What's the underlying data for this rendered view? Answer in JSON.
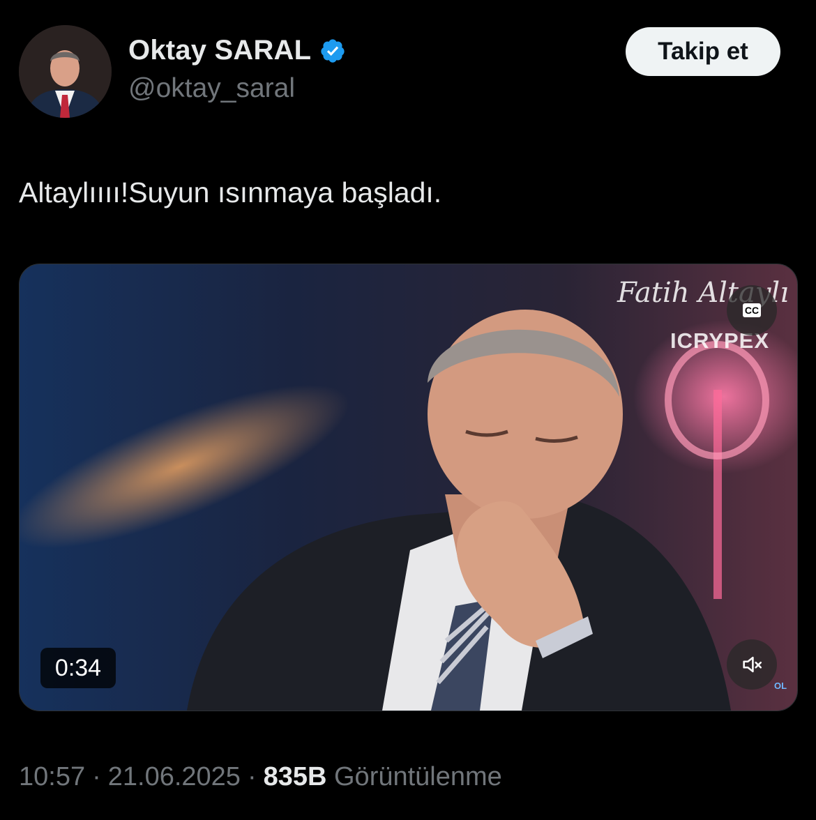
{
  "author": {
    "display_name": "Oktay SARAL",
    "handle": "@oktay_saral",
    "verified_icon": "verified-badge-icon"
  },
  "follow_button": {
    "label": "Takip et"
  },
  "tweet": {
    "text": "Altaylıııı!Suyun ısınmaya başladı."
  },
  "video": {
    "watermark_name": "Fatih Altaylı",
    "watermark_brand": "ICRYPEX",
    "duration": "0:34",
    "cc_label": "CC",
    "corner_logo": "OL"
  },
  "meta": {
    "time": "10:57",
    "date": "21.06.2025",
    "views_count": "835B",
    "views_label": "Görüntülenme",
    "separator": "·"
  },
  "colors": {
    "background": "#000000",
    "text_primary": "#e7e9ea",
    "text_secondary": "#71767b",
    "verified_blue": "#1d9bf0"
  }
}
